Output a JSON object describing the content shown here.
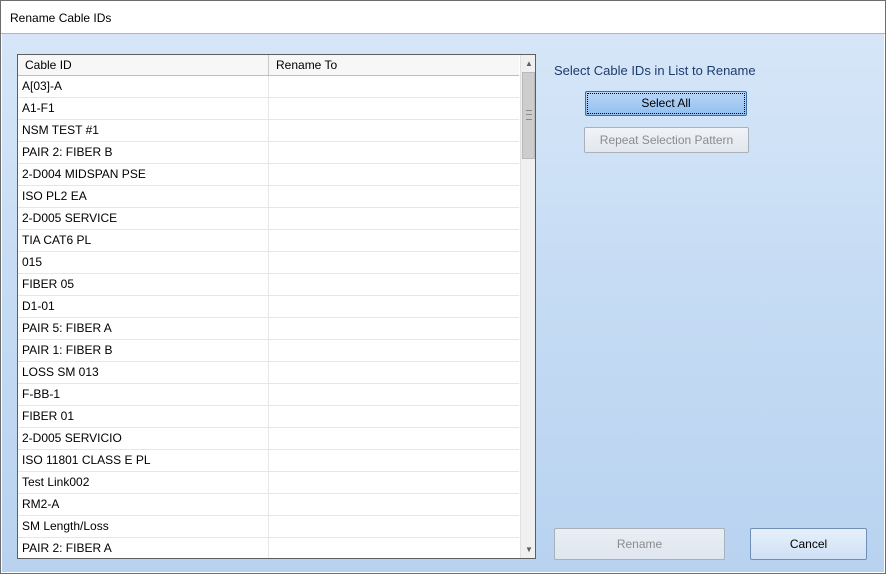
{
  "window": {
    "title": "Rename Cable IDs"
  },
  "grid": {
    "columns": [
      "Cable ID",
      "Rename To"
    ],
    "rows": [
      {
        "cable_id": "A[03]-A",
        "rename_to": ""
      },
      {
        "cable_id": "A1-F1",
        "rename_to": ""
      },
      {
        "cable_id": "NSM TEST #1",
        "rename_to": ""
      },
      {
        "cable_id": "PAIR 2: FIBER B",
        "rename_to": ""
      },
      {
        "cable_id": "2-D004 MIDSPAN PSE",
        "rename_to": ""
      },
      {
        "cable_id": "ISO PL2 EA",
        "rename_to": ""
      },
      {
        "cable_id": "2-D005 SERVICE",
        "rename_to": ""
      },
      {
        "cable_id": "TIA CAT6 PL",
        "rename_to": ""
      },
      {
        "cable_id": "015",
        "rename_to": ""
      },
      {
        "cable_id": "FIBER 05",
        "rename_to": ""
      },
      {
        "cable_id": "D1-01",
        "rename_to": ""
      },
      {
        "cable_id": "PAIR 5: FIBER A",
        "rename_to": ""
      },
      {
        "cable_id": "PAIR 1: FIBER B",
        "rename_to": ""
      },
      {
        "cable_id": "LOSS SM 013",
        "rename_to": ""
      },
      {
        "cable_id": "F-BB-1",
        "rename_to": ""
      },
      {
        "cable_id": "FIBER 01",
        "rename_to": ""
      },
      {
        "cable_id": "2-D005 SERVICIO",
        "rename_to": ""
      },
      {
        "cable_id": "ISO 11801 CLASS E PL",
        "rename_to": ""
      },
      {
        "cable_id": "Test Link002",
        "rename_to": ""
      },
      {
        "cable_id": "RM2-A",
        "rename_to": ""
      },
      {
        "cable_id": "SM Length/Loss",
        "rename_to": ""
      },
      {
        "cable_id": "PAIR 2: FIBER A",
        "rename_to": ""
      }
    ]
  },
  "side": {
    "prompt": "Select Cable IDs in List to Rename",
    "select_all_label": "Select All",
    "repeat_pattern_label": "Repeat Selection Pattern"
  },
  "footer": {
    "rename_label": "Rename",
    "cancel_label": "Cancel"
  },
  "icons": {
    "scroll_up": "triangle-up-icon",
    "scroll_down": "triangle-down-icon"
  }
}
